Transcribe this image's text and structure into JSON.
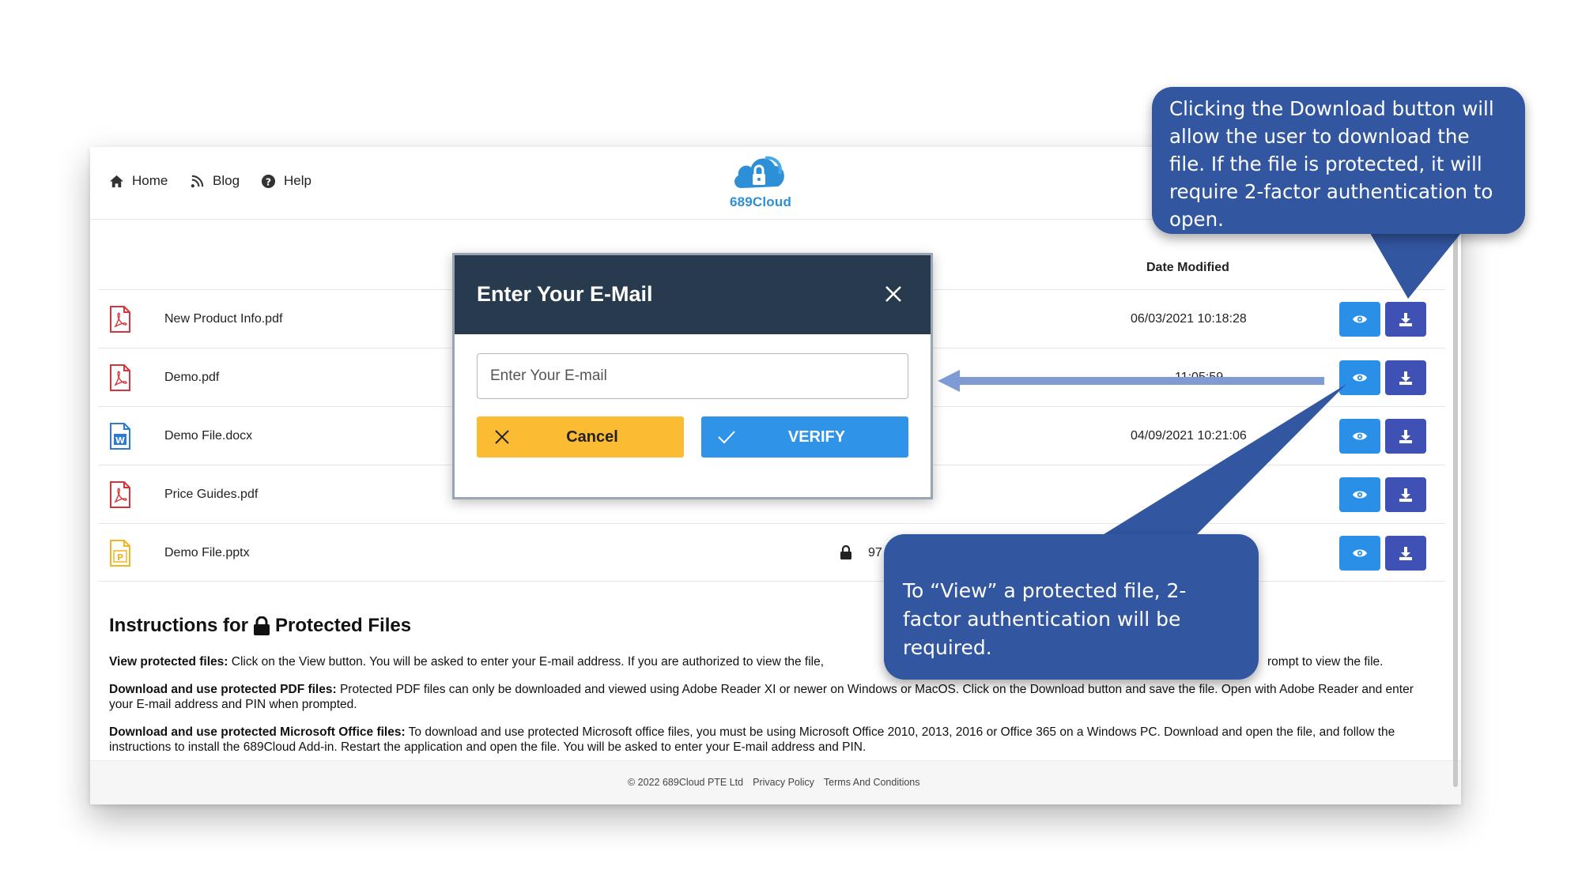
{
  "nav": {
    "home": "Home",
    "blog": "Blog",
    "help": "Help"
  },
  "logo": {
    "text": "689Cloud"
  },
  "table": {
    "date_header": "Date Modified",
    "rows": [
      {
        "name": "New Product Info.pdf",
        "type": "pdf",
        "locked": false,
        "size": "",
        "date": "06/03/2021 10:18:28"
      },
      {
        "name": "Demo.pdf",
        "type": "pdf",
        "locked": false,
        "size": "",
        "date": "11:05:59"
      },
      {
        "name": "Demo File.docx",
        "type": "docx",
        "locked": false,
        "size": "",
        "date": "04/09/2021 10:21:06"
      },
      {
        "name": "Price Guides.pdf",
        "type": "pdf",
        "locked": false,
        "size": "",
        "date": ""
      },
      {
        "name": "Demo File.pptx",
        "type": "pptx",
        "locked": true,
        "size": "97",
        "date": ""
      }
    ]
  },
  "instructions": {
    "title_pre": "Instructions for",
    "title_post": "Protected Files",
    "p1_bold": "View protected files:",
    "p1_text": " Click on the View button. You will be asked to enter your E-mail address. If you are authorized to view the file,",
    "p1_tail": "rompt to view the file.",
    "p2_bold": "Download and use protected PDF files:",
    "p2_text": " Protected PDF files can only be downloaded and viewed using Adobe Reader XI or newer on Windows or MacOS. Click on the Download button and save the file. Open with Adobe Reader and enter your E-mail address and PIN when prompted.",
    "p3_bold": "Download and use protected Microsoft Office files:",
    "p3_text": " To download and use protected Microsoft office files, you must be using Microsoft Office 2010, 2013, 2016 or Office 365 on a Windows PC. Download and open the file, and follow the instructions to install the 689Cloud Add-in. Restart the application and open the file. You will be asked to enter your E-mail address and PIN."
  },
  "footer": {
    "copyright": "© 2022 689Cloud PTE Ltd",
    "privacy": "Privacy Policy",
    "terms": "Terms And Conditions"
  },
  "modal": {
    "title": "Enter Your E-Mail",
    "input_placeholder": "Enter Your E-mail",
    "input_value": "",
    "cancel_label": "Cancel",
    "verify_label": "VERIFY"
  },
  "callouts": {
    "download": "Clicking the Download button will allow the user to download the file. If the file is protected, it will require 2-factor authentication to open.",
    "view": "To “View” a protected file, 2-factor authentication will be required."
  },
  "colors": {
    "view_button": "#2a8fe6",
    "download_button": "#3f51b5",
    "modal_header": "#283a4e",
    "cancel_button": "#fbbc34",
    "verify_button": "#2f93e8",
    "callout": "#3256a0",
    "pdf_icon": "#d9333a",
    "docx_icon": "#2b7bd3",
    "pptx_icon": "#f2b51f"
  }
}
